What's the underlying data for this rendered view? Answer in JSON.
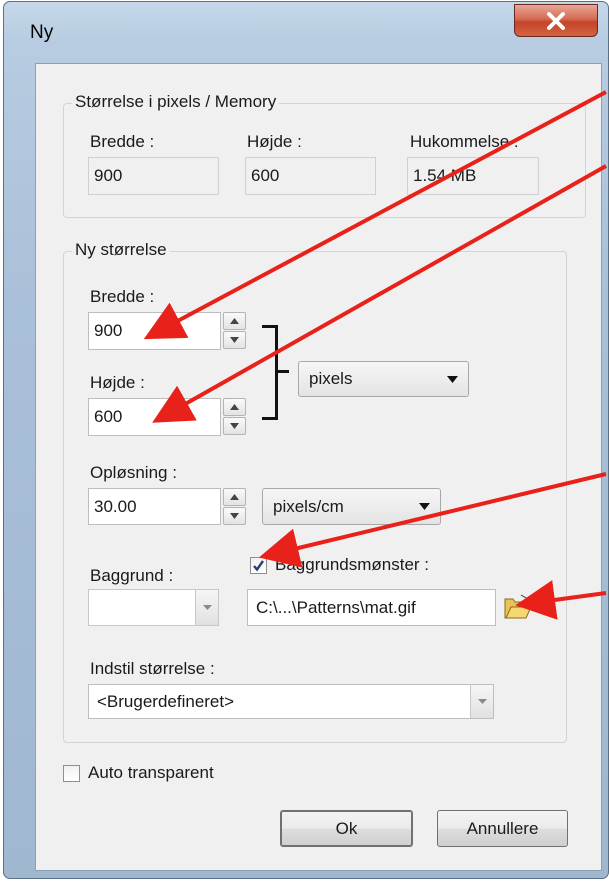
{
  "window": {
    "title": "Ny",
    "close_glyph": "X"
  },
  "memory_group": {
    "legend": "Størrelse i pixels / Memory",
    "width_label": "Bredde :",
    "width_value": "900",
    "height_label": "Højde :",
    "height_value": "600",
    "memory_label": "Hukommelse :",
    "memory_value": "1.54 MB"
  },
  "new_size_group": {
    "legend": "Ny størrelse",
    "width_label": "Bredde :",
    "width_value": "900",
    "height_label": "Højde :",
    "height_value": "600",
    "unit_selected": "pixels",
    "resolution_label": "Opløsning :",
    "resolution_value": "30.00",
    "resolution_unit_selected": "pixels/cm",
    "background_label": "Baggrund :",
    "background_color": "#ffffff",
    "pattern_label": "Baggrundsmønster :",
    "pattern_checked": true,
    "pattern_path": "C:\\...\\Patterns\\mat.gif",
    "preset_label": "Indstil størrelse :",
    "preset_selected": "<Brugerdefineret>"
  },
  "auto_transparent": {
    "label": "Auto transparent",
    "checked": false
  },
  "buttons": {
    "ok": "Ok",
    "cancel": "Annullere"
  },
  "icons": {
    "folder": "folder-open-icon",
    "close": "close-icon",
    "spin_up": "spin-up-icon",
    "spin_down": "spin-down-icon",
    "chevron": "chevron-down-icon",
    "check": "checkmark-icon"
  },
  "colors": {
    "annotation_arrow": "#e8211a",
    "title_bar": "#b7cce1",
    "close_button": "#c9502f",
    "dialog_background": "#f0f0f0"
  }
}
